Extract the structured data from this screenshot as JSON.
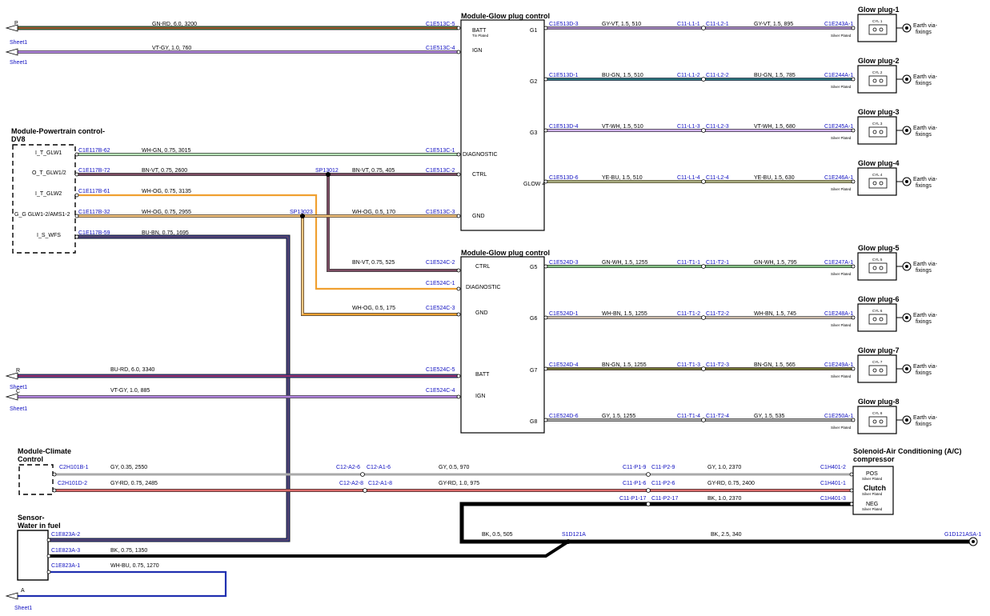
{
  "modules": {
    "glow_top": {
      "title": "Module-Glow plug control"
    },
    "glow_bottom": {
      "title": "Module-Glow plug control"
    },
    "pcm": {
      "title1": "Module-Powertrain control-",
      "title2": "DV8"
    },
    "climate": {
      "title1": "Module-Climate",
      "title2": "Control"
    },
    "sensor": {
      "title1": "Sensor-",
      "title2": "Water in fuel"
    },
    "solenoid": {
      "title1": "Solenoid-Air Conditioning (A/C)",
      "title2": "compressor"
    }
  },
  "pins_top": {
    "batt": "BATT",
    "tin": "Tin Plated",
    "ign": "IGN",
    "diag": "DIAGNOSTIC",
    "ctrl": "CTRL",
    "gnd": "GND",
    "g1": "G1",
    "g2": "G2",
    "g3": "G3",
    "glow4": "GLOW 4"
  },
  "pins_bottom": {
    "ctrl": "CTRL",
    "diag": "DIAGNOSTIC",
    "gnd": "GND",
    "g5": "G5",
    "g6": "G6",
    "batt": "BATT",
    "ign": "IGN",
    "g7": "G7",
    "g8": "G8"
  },
  "pcm_pins": [
    "I_T_GLW1",
    "O_T_GLW1/2",
    "I_T_GLW2",
    "G_G GLW1-2/AMS1-2",
    "I_S_WFS"
  ],
  "plug_common": {
    "earth1": "Earth via-",
    "earth2": "fixings",
    "silver": "Silver Plated"
  },
  "plugs": [
    {
      "title": "Glow plug-1",
      "cyl": "CYL 1",
      "conn": "C1E243A-1",
      "mod_conn": "C1E513D-3",
      "wire1": "GY-VT,  1.5,  510",
      "inline1": "C11-L1-1",
      "inline2": "C11-L2-1",
      "wire2": "GY-VT,  1.5,  895"
    },
    {
      "title": "Glow plug-2",
      "cyl": "CYL 2",
      "conn": "C1E244A-1",
      "mod_conn": "C1E513D-1",
      "wire1": "BU-GN,  1.5,  510",
      "inline1": "C11-L1-2",
      "inline2": "C11-L2-2",
      "wire2": "BU-GN,  1.5,  785"
    },
    {
      "title": "Glow plug-3",
      "cyl": "CYL 3",
      "conn": "C1E245A-1",
      "mod_conn": "C1E513D-4",
      "wire1": "VT-WH,  1.5,  510",
      "inline1": "C11-L1-3",
      "inline2": "C11-L2-3",
      "wire2": "VT-WH,  1.5,  680"
    },
    {
      "title": "Glow plug-4",
      "cyl": "CYL 4",
      "conn": "C1E246A-1",
      "mod_conn": "C1E513D-6",
      "wire1": "YE-BU,  1.5,  510",
      "inline1": "C11-L1-4",
      "inline2": "C11-L2-4",
      "wire2": "YE-BU,  1.5,  630"
    },
    {
      "title": "Glow plug-5",
      "cyl": "CYL 5",
      "conn": "C1E247A-1",
      "mod_conn": "C1E524D-3",
      "wire1": "GN-WH,  1.5,  1255",
      "inline1": "C11-T1-1",
      "inline2": "C11-T2-1",
      "wire2": "GN-WH,  1.5,  795"
    },
    {
      "title": "Glow plug-6",
      "cyl": "CYL 6",
      "conn": "C1E248A-1",
      "mod_conn": "C1E524D-1",
      "wire1": "WH-BN,  1.5,  1255",
      "inline1": "C11-T1-2",
      "inline2": "C11-T2-2",
      "wire2": "WH-BN,  1.5,  745"
    },
    {
      "title": "Glow plug-7",
      "cyl": "CYL 7",
      "conn": "C1E249A-1",
      "mod_conn": "C1E524D-4",
      "wire1": "BN-GN,  1.5,  1255",
      "inline1": "C11-T1-3",
      "inline2": "C11-T2-3",
      "wire2": "BN-GN,  1.5,  565"
    },
    {
      "title": "Glow plug-8",
      "cyl": "CYL 8",
      "conn": "C1E250A-1",
      "mod_conn": "C1E524D-6",
      "wire1": "GY,  1.5,  1255",
      "inline1": "C11-T1-4",
      "inline2": "C11-T2-4",
      "wire2": "GY,  1.5,  535"
    }
  ],
  "offpage": {
    "p": "P",
    "r": "R",
    "c": "C",
    "a": "A",
    "sheet": "Sheet1"
  },
  "labels": {
    "w_p": "GN-RD,  6.0,  3200",
    "c_p": "C1E513C-5",
    "w_vt1": "VT-GY,  1.0,  760",
    "c_vt1": "C1E513C-4",
    "pcm_c1": "C1E117B-62",
    "w_p1": "WH-GN,  0.75,  3015",
    "c_p1": "C1E513C-1",
    "pcm_c2": "C1E117B-72",
    "w_p2": "BN-VT,  0.75,  2600",
    "sp1": "SP13012",
    "w_p2b": "BN-VT,  0.75,  405",
    "c_p2": "C1E513C-2",
    "pcm_c3": "C1E117B-61",
    "w_p3": "WH-OG,  0.75,  3135",
    "pcm_c4": "C1E117B-32",
    "w_p4": "WH-OG,  0.75,  2955",
    "sp2": "SP13023",
    "w_p4b": "WH-OG,  0.5,  170",
    "c_p4": "C1E513C-3",
    "pcm_c5": "C1E117B-59",
    "w_p5": "BU-BN,  0.75,  1695",
    "w_b1": "BN-VT,  0.75,  525",
    "c_b1": "C1E524C-2",
    "c_b2": "C1E524C-1",
    "w_b3": "WH-OG,  0.5,  175",
    "c_b3": "C1E524C-3",
    "w_r": "BU-RD,  6.0,  3340",
    "c_r": "C1E524C-5",
    "w_vt2": "VT-GY,  1.0,  885",
    "c_vt2": "C1E524C-4",
    "cl_c1": "C2H101B-1",
    "cl_w1": "GY,  0.35,  2550",
    "i1a": "C12-A2-6",
    "i1b": "C12-A1-6",
    "cl_w1b": "GY,  0.5,  970",
    "i1c": "C11-P1-9",
    "i1d": "C11-P2-9",
    "cl_w1c": "GY,  1.0,  2370",
    "s_c1": "C1H401-2",
    "cl_c2": "C2H101D-2",
    "cl_w2": "GY-RD,  0.75,  2485",
    "i2a": "C12-A2-8",
    "i2b": "C12-A1-8",
    "cl_w2b": "GY-RD,  1.0,  975",
    "i2c": "C11-P1-6",
    "i2d": "C11-P2-6",
    "cl_w2c": "GY-RD,  0.75,  2400",
    "s_c2": "C1H401-1",
    "i3a": "C11-P1-17",
    "i3b": "C11-P2-17",
    "w3": "BK,  1.0,  2370",
    "s_c3": "C1H401-3",
    "sol_pos": "POS",
    "sol_clutch": "Clutch",
    "sol_neg": "NEG",
    "w_bk1": "BK,  0.5,  505",
    "sp3": "S1D121A",
    "w_bk2": "BK,  2.5,  340",
    "gnd_c": "G1D121ASA-1",
    "wf_c1": "C1E823A-2",
    "wf_c2": "C1E823A-3",
    "wf_w2": "BK,  0.75,  1350",
    "wf_c3": "C1E823A-1",
    "wf_w3": "WH-BU,  0.75,  1270"
  }
}
